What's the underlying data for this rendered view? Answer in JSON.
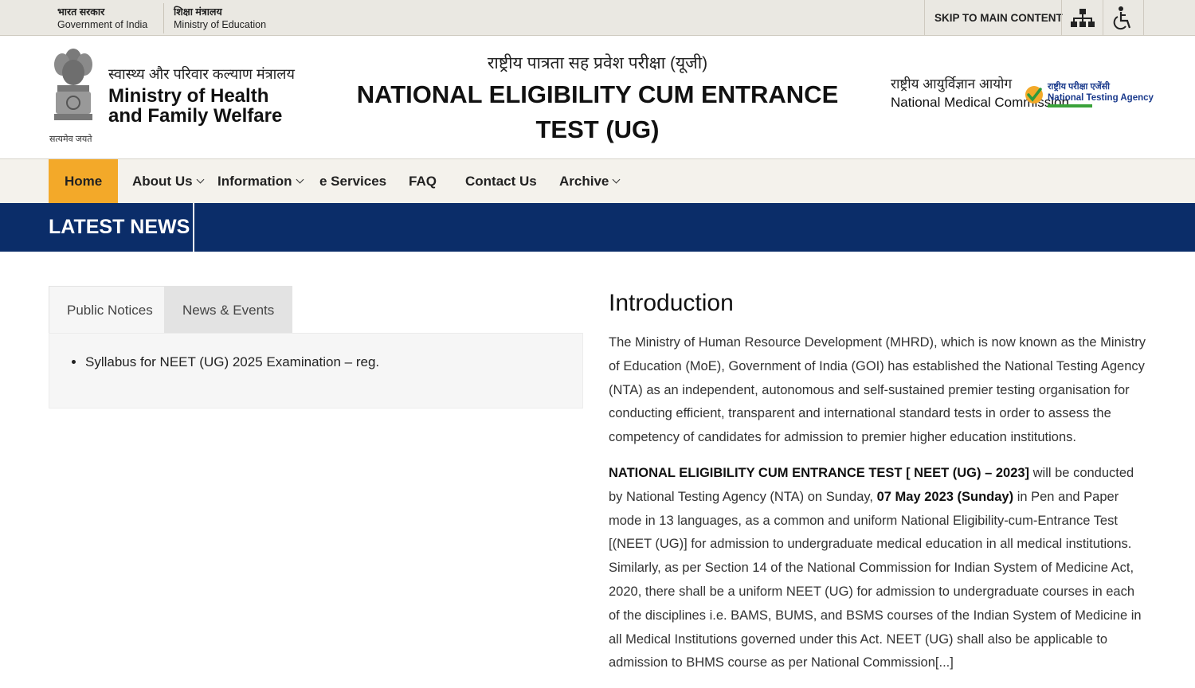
{
  "gov_bar": {
    "india_hi": "भारत सरकार",
    "india_en": "Government of India",
    "edu_hi": "शिक्षा मंत्रालय",
    "edu_en": "Ministry of Education",
    "skip_label": "SKIP TO MAIN CONTENT",
    "icons": [
      "sitemap-icon",
      "accessibility-icon"
    ]
  },
  "header": {
    "emblem_caption": "सत्यमेव जयते",
    "ministry_hi": "स्वास्थ्य और परिवार कल्याण मंत्रालय",
    "ministry_en": "Ministry of Health and Family Welfare",
    "title_hi": "राष्ट्रीय पात्रता सह प्रवेश परीक्षा (यूजी)",
    "title_en": "NATIONAL ELIGIBILITY CUM ENTRANCE TEST (UG)",
    "nmc_hi": "राष्ट्रीय आयुर्विज्ञान आयोग",
    "nmc_en": "National Medical Commission",
    "nta_hi": "राष्ट्रीय परीक्षा एजेंसी",
    "nta_en": "National Testing Agency"
  },
  "nav": {
    "items": [
      {
        "label": "Home",
        "active": true
      },
      {
        "label": "About Us",
        "dropdown": true
      },
      {
        "label": "Information",
        "dropdown": true
      },
      {
        "label": "e Services"
      },
      {
        "label": "FAQ"
      },
      {
        "label": "Contact Us"
      },
      {
        "label": "Archive",
        "dropdown": true
      }
    ]
  },
  "latest_news": {
    "label": "LATEST NEWS"
  },
  "tabs": {
    "items": [
      "Public Notices",
      "News & Events"
    ],
    "notices": [
      "Syllabus for NEET (UG) 2025 Examination – reg."
    ]
  },
  "intro": {
    "heading": "Introduction",
    "p1": "The Ministry of Human Resource Development (MHRD), which is now known as the Ministry of Education (MoE), Government of India (GOI) has established the National Testing Agency (NTA) as an independent, autonomous and self-sustained premier testing organisation for conducting efficient, transparent and international standard tests in order to assess the competency of candidates for admission to premier higher education institutions.",
    "p2_bold1": "NATIONAL ELIGIBILITY CUM ENTRANCE TEST [ NEET (UG) – 2023]",
    "p2_text1": " will be conducted by National Testing Agency (NTA) on Sunday, ",
    "p2_bold2": "07 May 2023 (Sunday)",
    "p2_text2": " in Pen and Paper mode in 13 languages, as a common and uniform National Eligibility-cum-Entrance Test [(NEET (UG)] for admission to undergraduate medical education in all medical institutions. Similarly, as per Section 14 of the National Commission for Indian System of Medicine Act, 2020, there shall be a uniform NEET (UG) for admission to undergraduate courses in each of the disciplines i.e. BAMS, BUMS, and BSMS courses of the Indian System of Medicine in all Medical Institutions governed under this Act. NEET (UG) shall also be applicable to admission to BHMS course as per National Commission",
    "read_more": "[...]"
  },
  "colors": {
    "nav_active": "#f3a929",
    "latest_bar": "#0b2d69",
    "top_bar": "#eae8e2",
    "nav_bg": "#f4f2ec"
  }
}
